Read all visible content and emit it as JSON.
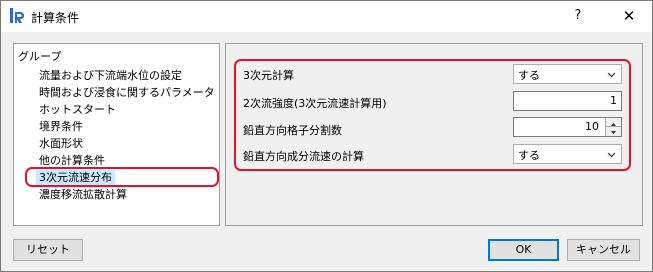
{
  "window": {
    "title": "計算条件",
    "help_label": "?",
    "close_label": "✕"
  },
  "groups": {
    "title": "グループ",
    "items": [
      {
        "label": "流量および下流端水位の設定"
      },
      {
        "label": "時間および浸食に関するパラメータ"
      },
      {
        "label": "ホットスタート"
      },
      {
        "label": "境界条件"
      },
      {
        "label": "水面形状"
      },
      {
        "label": "他の計算条件"
      },
      {
        "label": "3次元流速分布",
        "selected": true
      },
      {
        "label": "濃度移流拡散計算"
      }
    ]
  },
  "settings": {
    "rows": [
      {
        "label": "3次元計算",
        "type": "combo",
        "value": "する"
      },
      {
        "label": "2次流強度(3次元流速計算用)",
        "type": "text",
        "value": "1"
      },
      {
        "label": "鉛直方向格子分割数",
        "type": "spin",
        "value": "10"
      },
      {
        "label": "鉛直方向成分流速の計算",
        "type": "combo",
        "value": "する"
      }
    ]
  },
  "footer": {
    "reset_label": "リセット",
    "ok_label": "OK",
    "cancel_label": "キャンセル"
  },
  "colors": {
    "highlight": "#e8102a",
    "selection": "#cce8ff",
    "app_icon": "#2b6cd6"
  }
}
